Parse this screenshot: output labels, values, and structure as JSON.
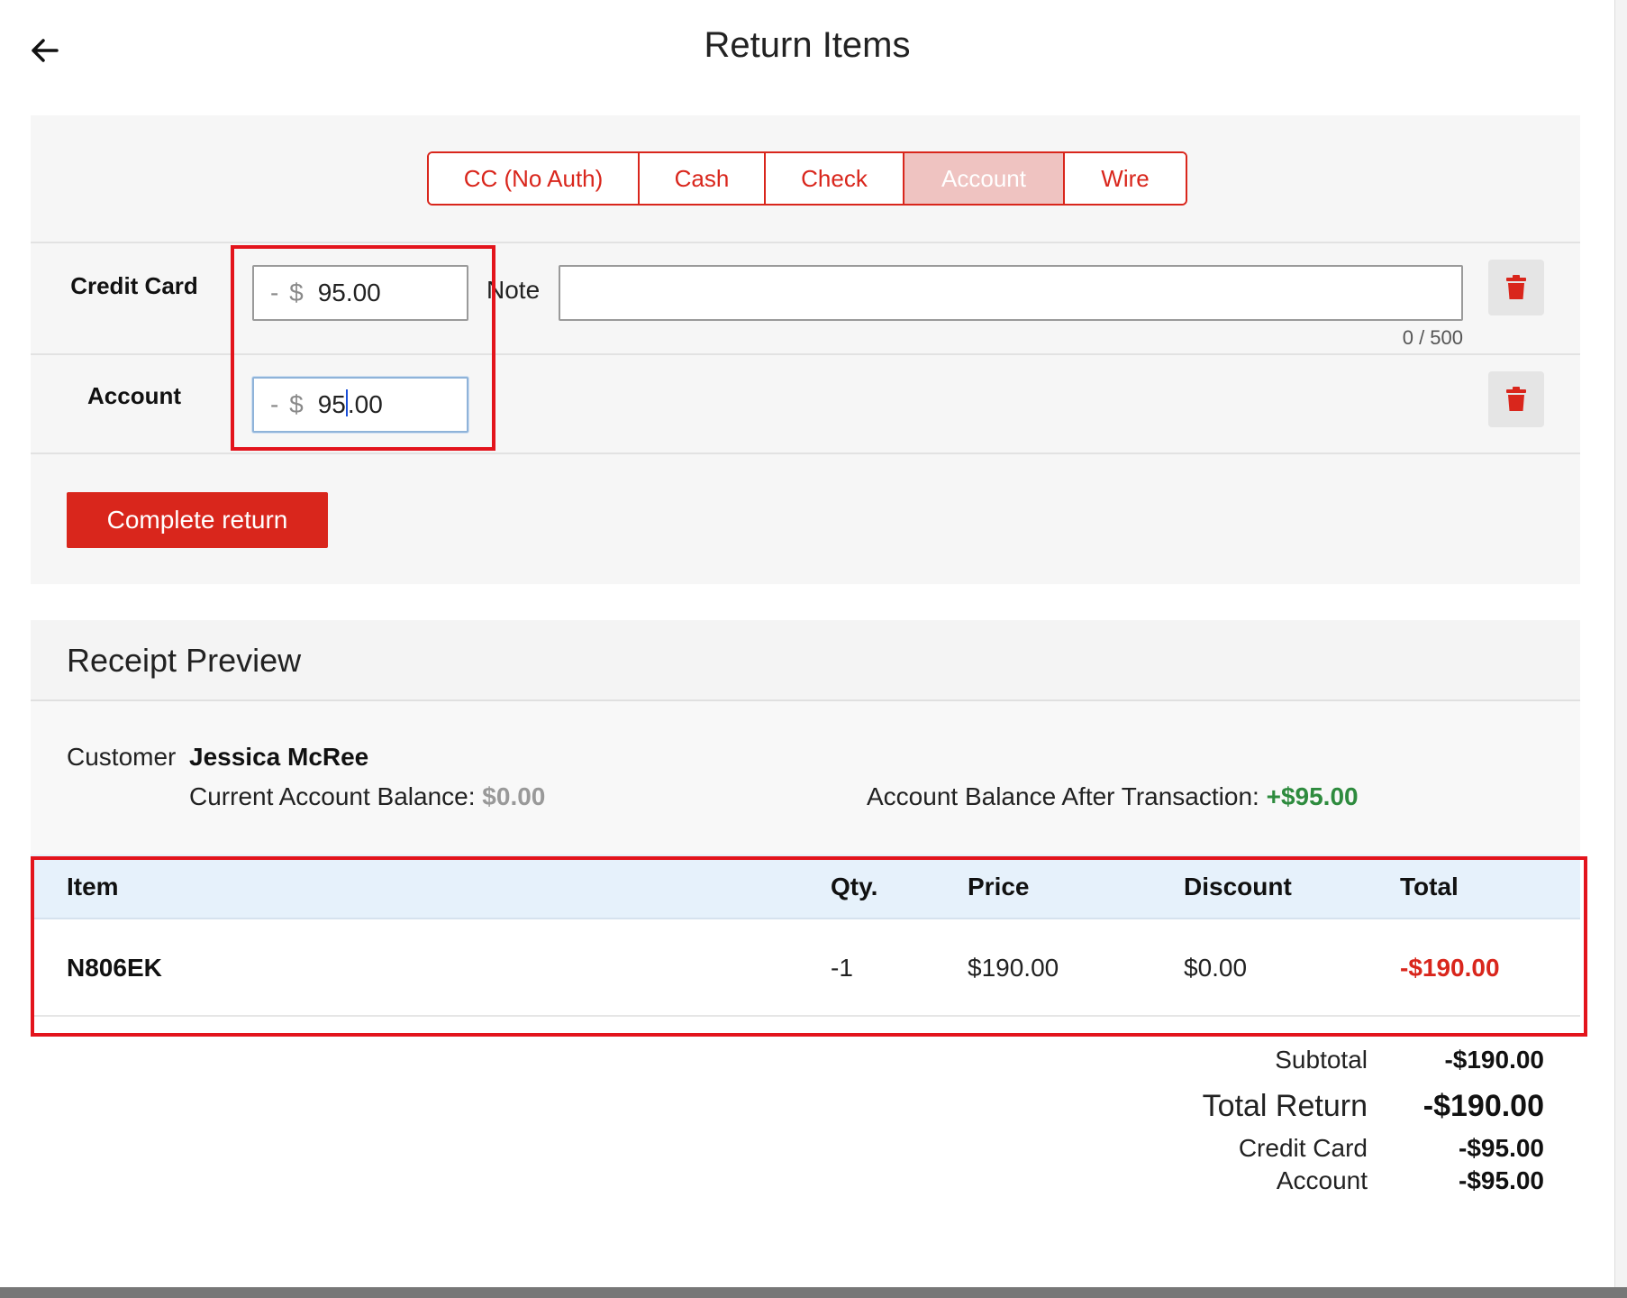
{
  "header": {
    "title": "Return Items",
    "back_icon": "arrow-left-icon"
  },
  "payment_tabs": [
    {
      "label": "CC (No Auth)",
      "active": false
    },
    {
      "label": "Cash",
      "active": false
    },
    {
      "label": "Check",
      "active": false
    },
    {
      "label": "Account",
      "active": true
    },
    {
      "label": "Wire",
      "active": false
    }
  ],
  "payments": [
    {
      "label": "Credit Card",
      "prefix": "- $",
      "amount": "95.00"
    },
    {
      "label": "Account",
      "prefix": "- $",
      "amount_before_caret": "95",
      "amount_after_caret": ".00"
    }
  ],
  "note": {
    "label": "Note",
    "value": "",
    "counter": "0 / 500"
  },
  "complete_button": "Complete return",
  "receipt": {
    "title": "Receipt Preview",
    "customer_label": "Customer",
    "customer_name": "Jessica McRee",
    "current_balance_label": "Current Account Balance:",
    "current_balance_value": "$0.00",
    "after_balance_label": "Account Balance After Transaction:",
    "after_balance_value": "+$95.00",
    "columns": {
      "item": "Item",
      "qty": "Qty.",
      "price": "Price",
      "discount": "Discount",
      "total": "Total"
    },
    "rows": [
      {
        "item": "N806EK",
        "qty": "-1",
        "price": "$190.00",
        "discount": "$0.00",
        "total": "-$190.00"
      }
    ],
    "totals": {
      "subtotal_label": "Subtotal",
      "subtotal_value": "-$190.00",
      "total_return_label": "Total Return",
      "total_return_value": "-$190.00",
      "credit_card_label": "Credit Card",
      "credit_card_value": "-$95.00",
      "account_label": "Account",
      "account_value": "-$95.00"
    }
  },
  "colors": {
    "accent": "#d9261c",
    "tab_active_bg": "#efc3c1",
    "positive": "#2e8b3e",
    "highlight": "#e3141c",
    "table_header_bg": "#e6f1fb"
  }
}
